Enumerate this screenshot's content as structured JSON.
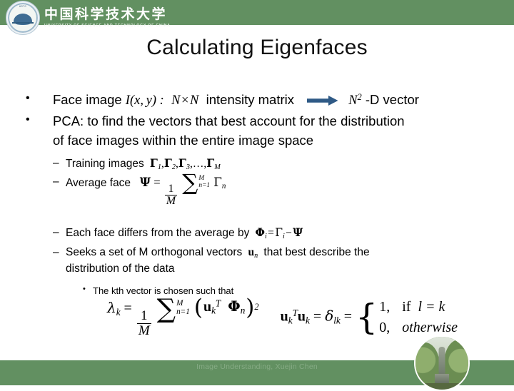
{
  "branding": {
    "university_cn": "中国科学技术大学",
    "university_en": "UNIVERSITY OF SCIENCE AND TECHNOLOGY OF CHINA",
    "seal_text": "USTC",
    "bar_color": "#629061",
    "accent_color": "#2F5A86"
  },
  "slide": {
    "title": "Calculating Eigenfaces"
  },
  "bullets": {
    "b1": {
      "pre": "Face image",
      "math_image": "I(x, y)",
      "colon": ":",
      "math_dims": "N × N",
      "mid": "intensity matrix",
      "arrow": "arrow-right",
      "math_vec": "N²",
      "post": "-D vector"
    },
    "b2": {
      "line1": "PCA: to find the vectors that best account for the distribution",
      "line2": "of face images within the entire image space"
    },
    "s1": {
      "dash": "–",
      "label": "Training images",
      "math": "Γ₁, Γ₂, Γ₃, …, Γ_M"
    },
    "s2": {
      "dash": "–",
      "label": "Average face",
      "math": "Ψ = (1/M) Σ_{n=1}^{M} Γ_n"
    },
    "s3": {
      "dash": "–",
      "label": "Each face differs from the average by",
      "math": "Φ_i = Γ_i − Ψ"
    },
    "s4": {
      "dash": "–",
      "line1a": "Seeks a set of M orthogonal vectors",
      "math": "u_n",
      "line1b": "that best describe the",
      "line2": "distribution of the data"
    },
    "s5": {
      "bullet": "•",
      "text": "The kth vector is chosen such that"
    }
  },
  "formula": {
    "lambda": "λ",
    "lambda_sub": "k",
    "equals": "=",
    "one": "1",
    "M": "M",
    "sigma": "∑",
    "sum_upper": "M",
    "sum_lower": "n=1",
    "u_bold": "u",
    "u_sub": "k",
    "u_sup": "T",
    "phi": "Φ",
    "phi_sub": "n",
    "power": "2",
    "ortho_u1_sub": "k",
    "ortho_u1_sup": "T",
    "ortho_u2_sub": "k",
    "delta": "δ",
    "delta_sub": "lk",
    "case1_value": "1,",
    "case1_cond": "if",
    "case1_expr": "l = k",
    "case2_value": "0,",
    "case2_cond": "otherwise"
  },
  "footer": {
    "text": "Image Understanding, Xuejin Chen",
    "color": "#86AB85"
  },
  "photo": {
    "caption": "campus-statue-photo"
  }
}
